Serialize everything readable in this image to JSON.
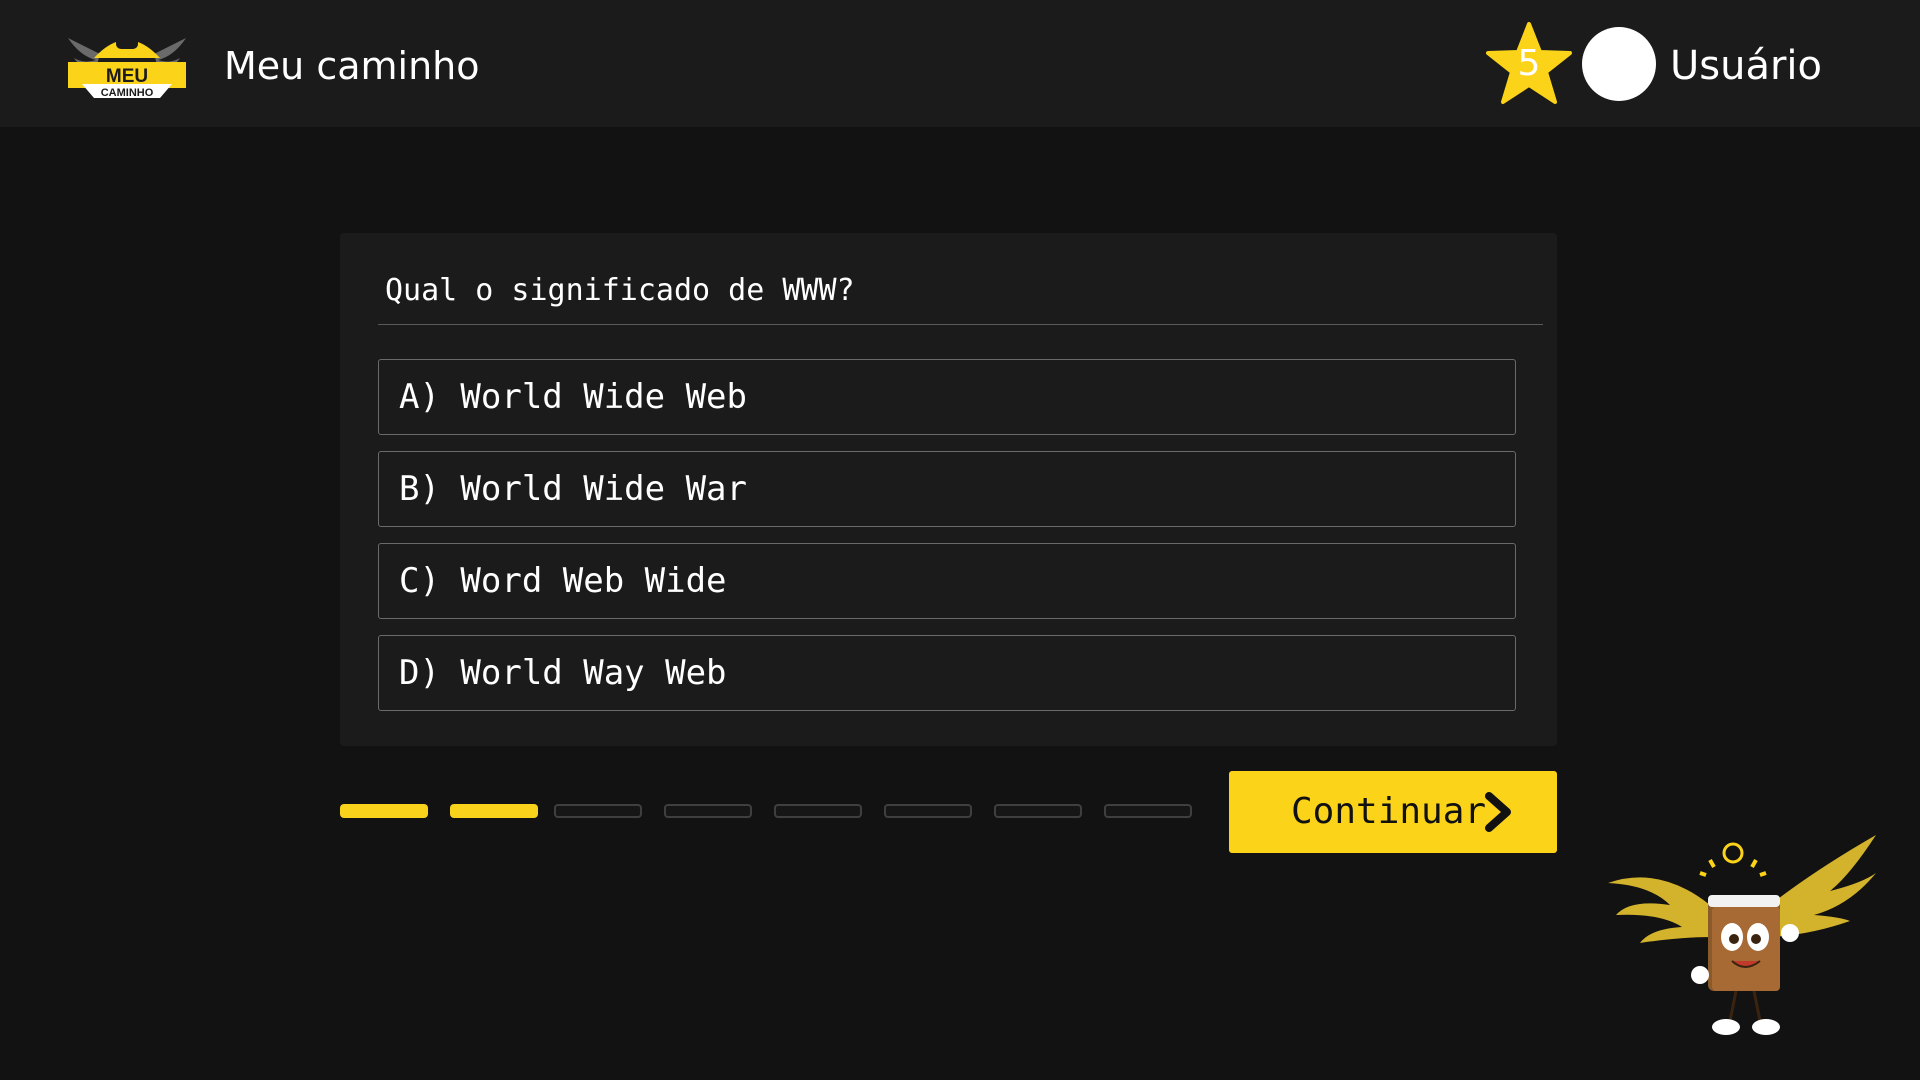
{
  "header": {
    "logo": {
      "line1": "MEU",
      "line2": "CAMINHO",
      "icon": "gamepad-icon"
    },
    "title": "Meu caminho",
    "level": "5",
    "user_name": "Usuário"
  },
  "quiz": {
    "question": "Qual o significado de WWW?",
    "options": [
      {
        "label": "A) World Wide Web"
      },
      {
        "label": "B) World Wide War"
      },
      {
        "label": "C) Word Web Wide"
      },
      {
        "label": "D) World Way Web"
      }
    ]
  },
  "progress": {
    "completed": 2,
    "total": 8
  },
  "continue_button": {
    "label": "Continuar",
    "icon": "chevron-right-icon"
  },
  "mascot": {
    "icon": "winged-book-mascot"
  },
  "colors": {
    "accent": "#fbd318",
    "background": "#121212",
    "panel": "#1b1b1b"
  }
}
